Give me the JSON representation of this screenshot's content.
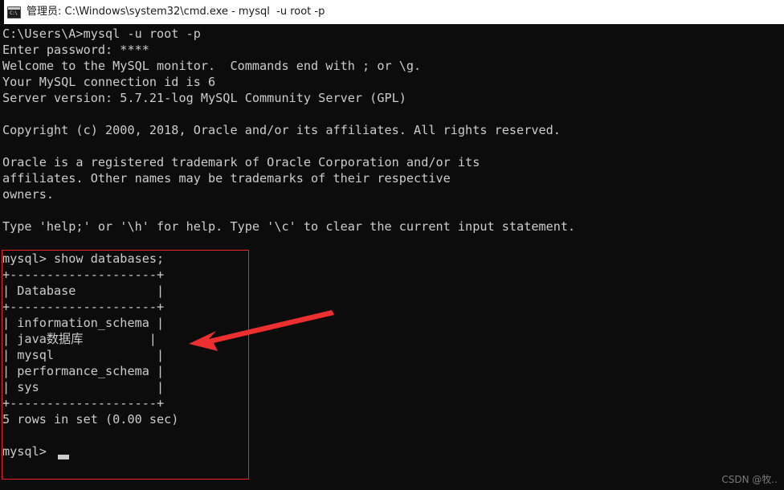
{
  "window": {
    "icon": "cmd-console-icon",
    "icon_glyph": "C:\\",
    "title": "管理员: C:\\Windows\\system32\\cmd.exe - mysql  -u root -p"
  },
  "terminal": {
    "foreground": "#cccccc",
    "background": "#0c0c0c",
    "lines": [
      "C:\\Users\\A>mysql -u root -p",
      "Enter password: ****",
      "Welcome to the MySQL monitor.  Commands end with ; or \\g.",
      "Your MySQL connection id is 6",
      "Server version: 5.7.21-log MySQL Community Server (GPL)",
      "",
      "Copyright (c) 2000, 2018, Oracle and/or its affiliates. All rights reserved.",
      "",
      "Oracle is a registered trademark of Oracle Corporation and/or its",
      "affiliates. Other names may be trademarks of their respective",
      "owners.",
      "",
      "Type 'help;' or '\\h' for help. Type '\\c' to clear the current input statement.",
      "",
      "mysql> show databases;",
      "+--------------------+",
      "| Database           |",
      "+--------------------+",
      "| information_schema |",
      "| java数据库         |",
      "| mysql              |",
      "| performance_schema |",
      "| sys                |",
      "+--------------------+",
      "5 rows in set (0.00 sec)",
      "",
      "mysql> "
    ],
    "command": "show databases;",
    "prompt": "mysql>",
    "result_table": {
      "header": "Database",
      "rows": [
        "information_schema",
        "java数据库",
        "mysql",
        "performance_schema",
        "sys"
      ],
      "footer": "5 rows in set (0.00 sec)"
    },
    "cursor": "block-cursor"
  },
  "annotations": {
    "color": "#ee2222",
    "box_label": "highlight-box-databases",
    "arrow_label": "pointer-arrow-to-database-list"
  },
  "watermark": {
    "text": "CSDN @牧.."
  }
}
